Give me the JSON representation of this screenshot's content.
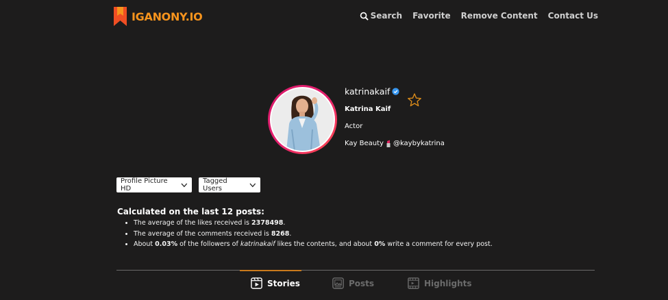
{
  "brand": {
    "name": "IGANONY.IO",
    "color": "#f7941d"
  },
  "nav": {
    "search": "Search",
    "favorite": "Favorite",
    "remove": "Remove Content",
    "contact": "Contact Us"
  },
  "profile": {
    "username": "katrinakaif",
    "full_name": "Katrina Kaif",
    "category": "Actor",
    "bio_prefix": "Kay Beauty",
    "bio_handle": "@kaybykatrina",
    "verified": true
  },
  "dropdowns": {
    "profile_picture": "Profile Picture HD",
    "tagged_users": "Tagged Users"
  },
  "stats": {
    "title": "Calculated on the last 12 posts:",
    "likes_prefix": "The average of the likes received is",
    "likes_value": "2378498",
    "comments_prefix": "The average of the comments received is",
    "comments_value": "8268",
    "engage_about": "About",
    "engage_pct": "0.03%",
    "engage_mid": "of the followers of",
    "engage_user": "katrinakaif",
    "engage_mid2": "likes the contents, and about",
    "engage_comment_pct": "0%",
    "engage_end": "write a comment for every post."
  },
  "tabs": {
    "stories": "Stories",
    "posts": "Posts",
    "highlights": "Highlights",
    "active": "Stories"
  },
  "colors": {
    "background": "#1d1c1c",
    "accent": "#c97a1c",
    "verified": "#3897f0",
    "ring": "#e6206f"
  }
}
